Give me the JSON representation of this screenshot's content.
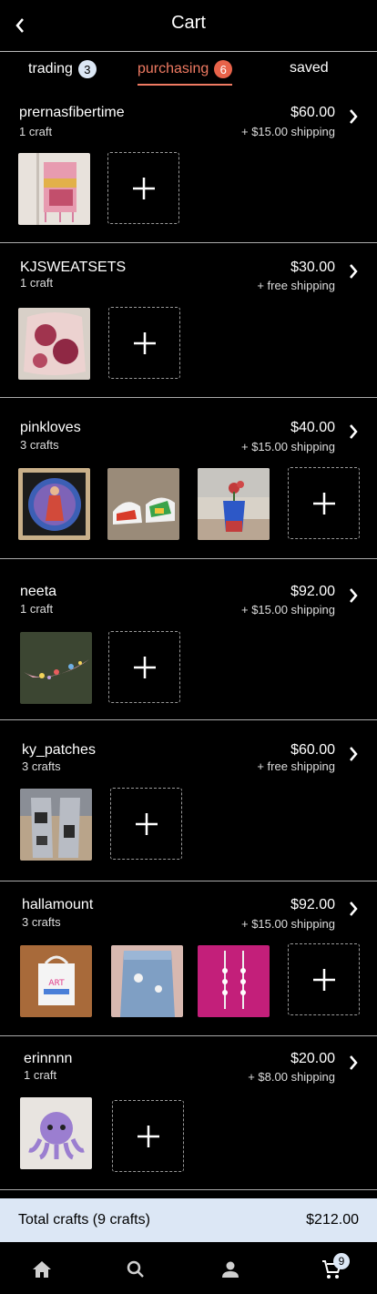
{
  "header": {
    "title": "Cart"
  },
  "tabs": [
    {
      "label": "trading",
      "badge": "3"
    },
    {
      "label": "purchasing",
      "badge": "6"
    },
    {
      "label": "saved"
    }
  ],
  "shops": [
    {
      "name": "prernasfibertime",
      "count": "1 craft",
      "price": "$60.00",
      "shipping": "+ $15.00 shipping"
    },
    {
      "name": "KJSWEATSETS",
      "count": "1 craft",
      "price": "$30.00",
      "shipping": "+ free shipping"
    },
    {
      "name": "pinkloves",
      "count": "3 crafts",
      "price": "$40.00",
      "shipping": "+ $15.00 shipping"
    },
    {
      "name": "neeta",
      "count": "1 craft",
      "price": "$92.00",
      "shipping": "+ $15.00 shipping"
    },
    {
      "name": "ky_patches",
      "count": "3 crafts",
      "price": "$60.00",
      "shipping": "+ free shipping"
    },
    {
      "name": "hallamount",
      "count": "3 crafts",
      "price": "$92.00",
      "shipping": "+ $15.00 shipping"
    },
    {
      "name": "erinnnn",
      "count": "1 craft",
      "price": "$20.00",
      "shipping": "+ $8.00 shipping"
    }
  ],
  "total": {
    "label": "Total crafts (9 crafts)",
    "value": "$212.00"
  },
  "nav": {
    "cart_badge": "9"
  },
  "icons": {
    "back": "chevron-left-icon",
    "chevron": "chevron-right-icon",
    "add": "plus-icon",
    "home": "home-icon",
    "search": "search-icon",
    "profile": "person-icon",
    "cart": "cart-icon"
  },
  "colors": {
    "accent": "#ef7a62",
    "badge_blue": "#dce7f5",
    "background": "#000000"
  }
}
